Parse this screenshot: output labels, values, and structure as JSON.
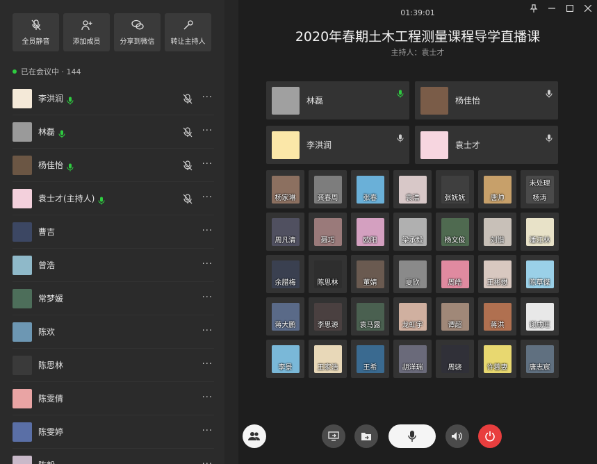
{
  "toolbar": {
    "mute_all": "全员静音",
    "add_member": "添加成员",
    "share_wechat": "分享到微信",
    "transfer_host": "转让主持人"
  },
  "meeting_status": "已在会议中 · 144",
  "participants": [
    {
      "name": "李洪润",
      "mic": true,
      "muted": true,
      "color": "#f4e9d8"
    },
    {
      "name": "林磊",
      "mic": true,
      "muted": true,
      "color": "#9a9a9a"
    },
    {
      "name": "杨佳怡",
      "mic": true,
      "muted": true,
      "color": "#6b5644"
    },
    {
      "name": "袁士才(主持人)",
      "mic": true,
      "muted": true,
      "color": "#f3d0dc"
    },
    {
      "name": "曹吉",
      "mic": false,
      "muted": false,
      "color": "#3c4763"
    },
    {
      "name": "曾浩",
      "mic": false,
      "muted": false,
      "color": "#8fb9c9"
    },
    {
      "name": "常梦媛",
      "mic": false,
      "muted": false,
      "color": "#4d6e5a"
    },
    {
      "name": "陈欢",
      "mic": false,
      "muted": false,
      "color": "#6d97b3"
    },
    {
      "name": "陈思林",
      "mic": false,
      "muted": false,
      "color": "#3a3a3a"
    },
    {
      "name": "陈雯倩",
      "mic": false,
      "muted": false,
      "color": "#e9a4a4"
    },
    {
      "name": "陈雯婷",
      "mic": false,
      "muted": false,
      "color": "#5a6fa6"
    },
    {
      "name": "陈毅",
      "mic": false,
      "muted": false,
      "color": "#c9b9c9"
    }
  ],
  "header": {
    "clock": "01:39:01",
    "title": "2020年春期土木工程测量课程导学直播课",
    "host": "主持人：袁士才"
  },
  "speakers": [
    {
      "name": "林磊",
      "active": true,
      "color": "#a0a0a0"
    },
    {
      "name": "杨佳怡",
      "active": false,
      "color": "#7a5c48"
    },
    {
      "name": "李洪润",
      "active": false,
      "color": "#fbe7a8"
    },
    {
      "name": "袁士才",
      "active": false,
      "color": "#f7d6e0"
    }
  ],
  "grid": [
    {
      "name": "杨家琳",
      "color": "#8c7060"
    },
    {
      "name": "龚春周",
      "color": "#7d7d7d"
    },
    {
      "name": "张春",
      "color": "#6ab0d8"
    },
    {
      "name": "袁浩",
      "color": "#d8c8c8"
    },
    {
      "name": "张妩妩",
      "color": "#3f3f3f"
    },
    {
      "name": "唐帅",
      "color": "#c7a06a"
    },
    {
      "name": "杨涛",
      "sub": "未处理",
      "color": "#4a4a4a"
    },
    {
      "name": "周凡清",
      "color": "#505060"
    },
    {
      "name": "聂巧",
      "color": "#9a7a7a"
    },
    {
      "name": "欧阳",
      "color": "#d4a0c0"
    },
    {
      "name": "梁承毅",
      "color": "#b0b0b0"
    },
    {
      "name": "杨文俊",
      "color": "#4f6a50"
    },
    {
      "name": "刘锴",
      "color": "#c8c0b8"
    },
    {
      "name": "潘江林",
      "color": "#e8e2c8"
    },
    {
      "name": "余腊梅",
      "color": "#3a4050"
    },
    {
      "name": "陈思林",
      "color": "#2e2e2e"
    },
    {
      "name": "董婧",
      "color": "#6a5a50"
    },
    {
      "name": "夏欣",
      "color": "#8a8a8a"
    },
    {
      "name": "周皓",
      "color": "#e08aa0"
    },
    {
      "name": "王彬懋",
      "color": "#d8c8c0"
    },
    {
      "name": "陈草傑",
      "color": "#9ad0e8"
    },
    {
      "name": "蒋大鹏",
      "color": "#5a6a88"
    },
    {
      "name": "李思源",
      "color": "#4a4040"
    },
    {
      "name": "袁马露",
      "color": "#4a6050"
    },
    {
      "name": "龙虹宇",
      "color": "#d0b0a0"
    },
    {
      "name": "谭超",
      "color": "#a08878"
    },
    {
      "name": "蒋洪",
      "color": "#b07050"
    },
    {
      "name": "谢成旺",
      "color": "#e8e8e8"
    },
    {
      "name": "李景",
      "color": "#7ab8d8"
    },
    {
      "name": "王家浩",
      "color": "#e8d8b8"
    },
    {
      "name": "王希",
      "color": "#3a6a90"
    },
    {
      "name": "胡洋瑞",
      "color": "#6a6a7a"
    },
    {
      "name": "周骁",
      "color": "#303038"
    },
    {
      "name": "许蓉妻",
      "color": "#e8d870"
    },
    {
      "name": "唐志宸",
      "color": "#607080"
    }
  ],
  "colors": {
    "accent_green": "#2ecc40",
    "end_red": "#e83e3e"
  },
  "icons": {
    "mute_all": "mic-off-icon",
    "add_member": "add-user-icon",
    "share_wechat": "wechat-icon",
    "transfer_host": "pen-icon",
    "members": "members-icon",
    "share_screen": "share-screen-icon",
    "share_file": "file-share-icon",
    "mic": "mic-icon",
    "speaker": "speaker-icon",
    "end": "power-icon"
  }
}
